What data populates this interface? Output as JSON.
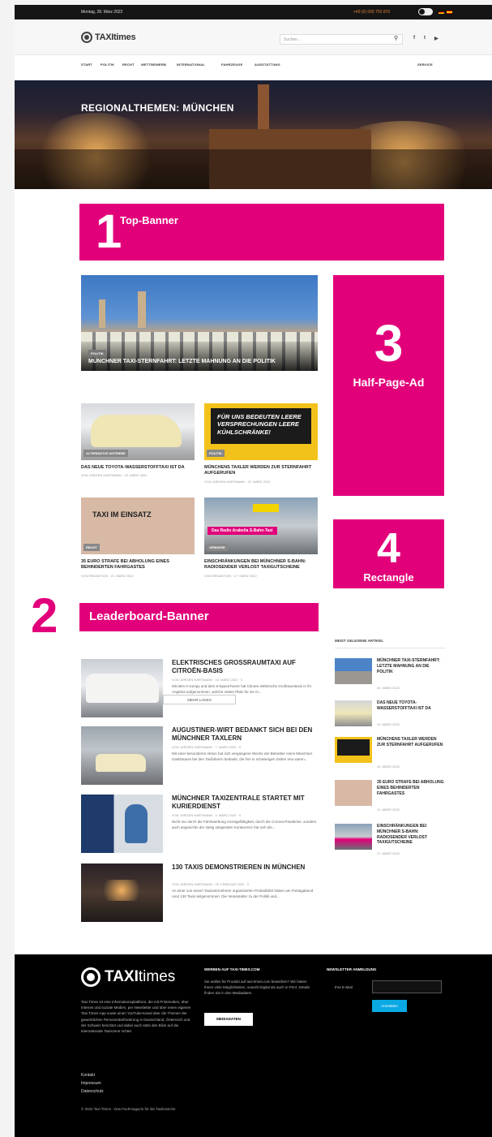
{
  "topbar": {
    "date": "Montag, 28. März 2022",
    "phone": "+49 (0) 000 752 870"
  },
  "header": {
    "logo_taxi": "TAXI",
    "logo_times": "times",
    "search_placeholder": "Suchen...",
    "social": [
      "f",
      "t",
      "▶"
    ]
  },
  "nav": {
    "items": [
      "START",
      "POLITIK",
      "RECHT",
      "WETTBEWERB",
      "INTERNATIONAL",
      "FAHRZEUGE",
      "AUSSTATTUNG"
    ],
    "service": "SERVICE"
  },
  "hero": {
    "title": "REGIONALTHEMEN: MÜNCHEN"
  },
  "ads": {
    "top": {
      "num": "1",
      "label": "Top-Banner"
    },
    "leaderboard": {
      "num": "2",
      "label": "Leaderboard-Banner"
    },
    "halfpage": {
      "num": "3",
      "label": "Half-Page-Ad"
    },
    "rectangle": {
      "num": "4",
      "label": "Rectangle"
    }
  },
  "featured": {
    "tag": "POLITIK",
    "title": "MÜNCHNER TAXI-STERNFAHRT: LETZTE MAHNUNG AN DIE POLITIK",
    "meta": "VON JÜRGEN HARTMANN · 24. MÄRZ 2022"
  },
  "cards": [
    {
      "tag": "ALTERNATIVE ANTRIEBE",
      "title": "DAS NEUE TOYOTA-WASSERSTOFFTAXI IST DA",
      "meta": "VON JÜRGEN HARTMANN · 23. MÄRZ 2022",
      "overlay": ""
    },
    {
      "tag": "POLITIK",
      "title": "MÜNCHENS TAXLER WERDEN ZUR STERNFAHRT AUFGERUFEN",
      "meta": "VON JÜRGEN HARTMANN · 22. MÄRZ 2022",
      "overlay": "FÜR UNS BEDEUTEN LEERE VERSPRECHUNGEN LEERE KÜHLSCHRÄNKE!"
    },
    {
      "tag": "RECHT",
      "title": "35 EURO STRAFE BEI ABHOLUNG EINES BEHINDERTEN FAHRGASTES",
      "meta": "VON REDAKTION · 21. MÄRZ 2022",
      "overlay": "TAXI IM EINSATZ"
    },
    {
      "tag": "VERKEHR",
      "title": "EINSCHRÄNKUNGEN BEI MÜNCHNER S-BAHN: RADIOSENDER VERLOST TAXIGUTSCHEINE",
      "meta": "VON REDAKTION · 17. MÄRZ 2022",
      "overlay": "Das Radio Arabella S-Bahn-Taxi"
    }
  ],
  "list": [
    {
      "title": "ELEKTRISCHES GROSSRAUMTAXI AUF CITROËN-BASIS",
      "meta": "VON JÜRGEN HARTMANN · 10. MÄRZ 2022 · 0",
      "excerpt": "Mit dem ë-Jumpy und dem ë-SpaceTourer hat Citroën elektrische Großraumtaxis in ihr Angebot aufgenommen, welche neben Platz für sie m..."
    },
    {
      "title": "AUGUSTINER-WIRT BEDANKT SICH BEI DEN MÜNCHNER TAXLERN",
      "meta": "VON JÜRGEN HARTMANN · 7. MÄRZ 2022 · 0",
      "excerpt": "Mit einer besonderen Aktion hat sich vergangene Woche der Betreiber eines Münchner Gasthauses bei den Taxifahrern bedankt, die ihm in schwierigen Zeiten treu waren..."
    },
    {
      "title": "MÜNCHNER TAXIZENTRALE STARTET MIT KURIERDIENST",
      "meta": "VON JÜRGEN HARTMANN · 4. MÄRZ 2022 · 0",
      "excerpt": "Nicht nur durch die Fahrtwerbung Anzeigefähigkeit, durch die Corona-Pandemie, sondern auch angesichts der stetig steigenden Konkurrenz hat sich die..."
    },
    {
      "title": "130 TAXIS DEMONSTRIEREN IN MÜNCHEN",
      "meta": "VON JÜRGEN HARTMANN · 25. FEBRUAR 2022 · 0",
      "excerpt": "An einer von einem Taxiunternehmer organisierten Protestfahrt haben am Freitagabend rund 130 Taxis teilgenommen. Die Veranstalter zu der Politik und..."
    }
  ],
  "more_button": "MEHR LADEN",
  "sidebar": {
    "heading": "MEIST GELESENE ARTIKEL",
    "items": [
      {
        "title": "MÜNCHNER TAXI-STERNFAHRT: LETZTE MAHNUNG AN DIE POLITIK",
        "date": "24. MÄRZ 2022"
      },
      {
        "title": "DAS NEUE TOYOTA-WASSERSTOFFTAXI IST DA",
        "date": "23. MÄRZ 2022"
      },
      {
        "title": "MÜNCHENS TAXLER WERDEN ZUR STERNFAHRT AUFGERUFEN",
        "date": "22. MÄRZ 2022"
      },
      {
        "title": "35 EURO STRAFE BEI ABHOLUNG EINES BEHINDERTEN FAHRGASTES",
        "date": "21. MÄRZ 2022"
      },
      {
        "title": "EINSCHRÄNKUNGEN BEI MÜNCHNER S-BAHN: RADIOSENDER VERLOST TAXIGUTSCHEINE",
        "date": "17. MÄRZ 2022"
      }
    ]
  },
  "footer": {
    "logo_taxi": "TAXI",
    "logo_times": "times",
    "about": "Taxi Times ist eine Informationsplattform, die mit Printmedien, über Internet und soziale Medien, per Newsletter und über einen eigenen Taxi Times-App sowie einen YouTube-Kanal über die Themen der gewerblichen Personenbeförderung in Deutschland, Österreich und der Schweiz berichtet und dabei auch stets den Blick auf die internationale Taxiszene richtet.",
    "werben_h": "WERBEN AUF TAXI-TIMES.COM",
    "werben_txt": "Sie wollen für Produkt auf taxi-times.com bewerben? Wir bieten Ihnen viele Möglichkeiten, sowohl Digital als auch in Print. Details finden Sie in den Mediadaten.",
    "werben_btn": "MEDIADATEN",
    "newsletter_h": "NEWSLETTER ANMELDUNG",
    "email_label": "Ihre E-Mail",
    "subscribe": "Anmelden",
    "links": [
      "Kontakt",
      "Impressum",
      "Datenschutz"
    ],
    "copyright": "© 2022 Taxi Times - Das Fachmagazin für die Taxibranche"
  },
  "colors": {
    "accent": "#e2007a",
    "dark": "#000000",
    "button_blue": "#0aa9e4"
  }
}
